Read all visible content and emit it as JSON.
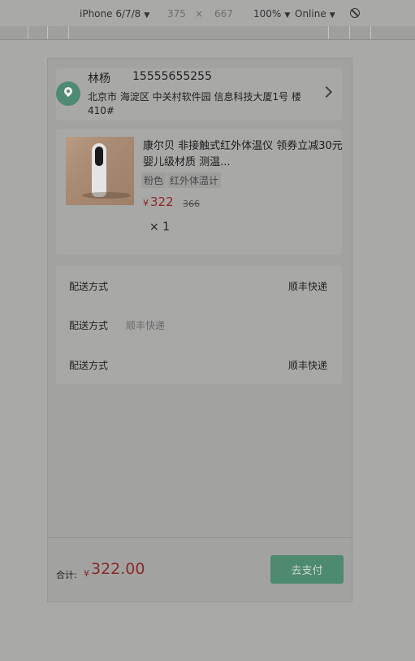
{
  "devtools": {
    "device": "iPhone 6/7/8",
    "width": "375",
    "times": "×",
    "height": "667",
    "zoom": "100%",
    "network": "Online",
    "caret": "▼"
  },
  "address": {
    "name": "林杨",
    "phone": "15555655255",
    "line": "北京市 海淀区 中关村软件园 信息科技大厦1号 楼410#"
  },
  "product": {
    "title": "康尔贝 非接触式红外体温仪 领券立减30元 婴儿级材质 测温...",
    "specs": [
      "粉色",
      "红外体温计"
    ],
    "currency": "¥",
    "price": "322",
    "original_price": "366",
    "quantity": "× 1"
  },
  "shipping": [
    {
      "label": "配送方式",
      "value": "顺丰快递",
      "align": "right"
    },
    {
      "label": "配送方式",
      "value": "顺丰快递",
      "align": "left"
    },
    {
      "label": "配送方式",
      "value": "顺丰快递",
      "align": "right"
    }
  ],
  "footer": {
    "total_label": "合计:",
    "currency": "¥",
    "total": "322.00",
    "pay_button": "去支付"
  },
  "colors": {
    "accent": "#4d8a6f",
    "price": "#8a2a2a",
    "overlay_bg": "#a9a9a8"
  }
}
